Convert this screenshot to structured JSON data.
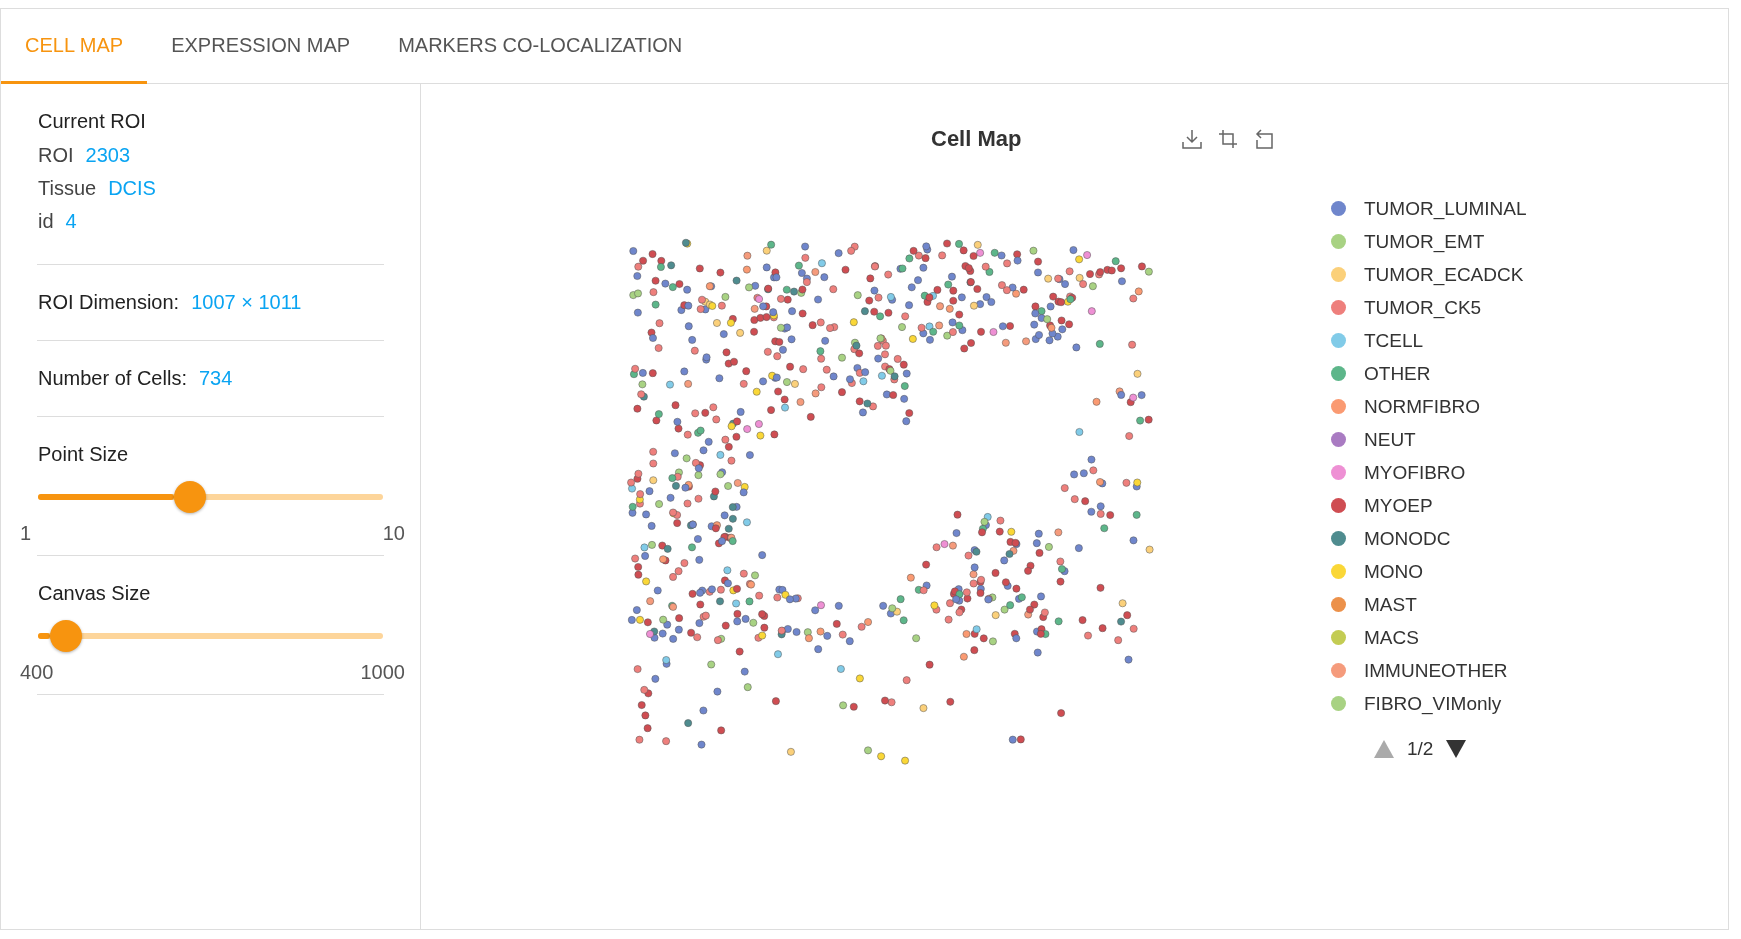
{
  "tabs": [
    {
      "label": "CELL MAP",
      "selected": true
    },
    {
      "label": "EXPRESSION MAP",
      "selected": false
    },
    {
      "label": "MARKERS CO-LOCALIZATION",
      "selected": false
    }
  ],
  "roi_info": {
    "heading": "Current ROI",
    "fields": [
      {
        "label": "ROI",
        "value": "2303"
      },
      {
        "label": "Tissue",
        "value": "DCIS"
      },
      {
        "label": "id",
        "value": "4"
      }
    ]
  },
  "stats": [
    {
      "label": "ROI Dimension:",
      "value": "1007 × 1011"
    },
    {
      "label": "Number of Cells:",
      "value": "734"
    }
  ],
  "sliders": [
    {
      "label": "Point Size",
      "level": 0.44,
      "min": "1",
      "max": "10"
    },
    {
      "label": "Canvas Size",
      "level": 0.08,
      "min": "400",
      "max": "1000"
    }
  ],
  "plot": {
    "title": "Cell Map",
    "legend": [
      {
        "label": "TUMOR_LUMINAL",
        "color": "#6f86cc"
      },
      {
        "label": "TUMOR_EMT",
        "color": "#a8d283"
      },
      {
        "label": "TUMOR_ECADCK",
        "color": "#fbd07a"
      },
      {
        "label": "TUMOR_CK5",
        "color": "#ee7f7c"
      },
      {
        "label": "TCELL",
        "color": "#81cbe8"
      },
      {
        "label": "OTHER",
        "color": "#5db68a"
      },
      {
        "label": "NORMFIBRO",
        "color": "#fa9a72"
      },
      {
        "label": "NEUT",
        "color": "#a97bc2"
      },
      {
        "label": "MYOFIBRO",
        "color": "#ee90d4"
      },
      {
        "label": "MYOEP",
        "color": "#cf4d52"
      },
      {
        "label": "MONODC",
        "color": "#4f8c8f"
      },
      {
        "label": "MONO",
        "color": "#fad737"
      },
      {
        "label": "MAST",
        "color": "#ec914a"
      },
      {
        "label": "MACS",
        "color": "#c3cc53"
      },
      {
        "label": "IMMUNEOTHER",
        "color": "#f59b7c"
      },
      {
        "label": "FIBRO_VIMonly",
        "color": "#a8d283"
      }
    ],
    "pager": {
      "text": "1/2",
      "prev_enabled": false,
      "next_enabled": true
    }
  }
}
